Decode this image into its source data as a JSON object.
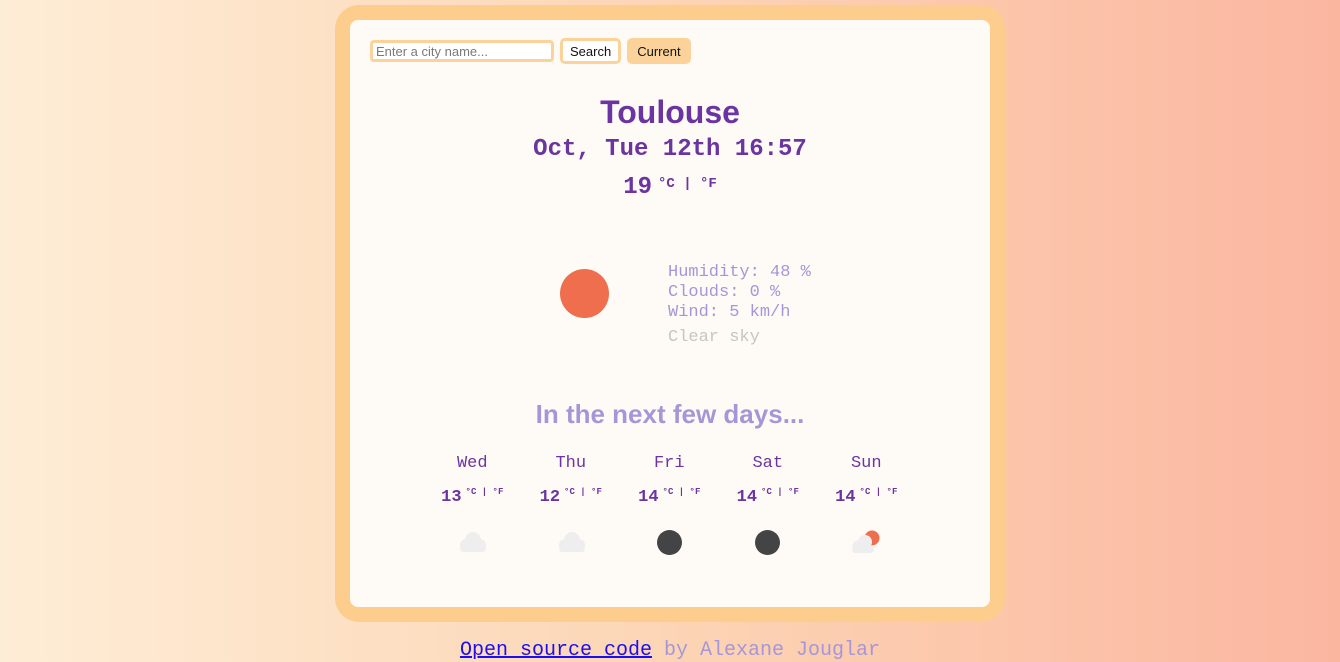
{
  "search": {
    "placeholder": "Enter a city name...",
    "value": ""
  },
  "buttons": {
    "search_label": "Search",
    "current_label": "Current"
  },
  "weather": {
    "city": "Toulouse",
    "datetime": "Oct, Tue 12th 16:57",
    "temperature": "19",
    "units": "°C | °F",
    "icon": "sun-icon",
    "humidity": "Humidity: 48 %",
    "clouds": "Clouds: 0 %",
    "wind": "Wind: 5 km/h",
    "description": "Clear sky"
  },
  "forecast": {
    "title": "In the next few days...",
    "units": "°C | °F",
    "days": [
      {
        "day": "Wed",
        "temp": "13",
        "icon": "cloud-icon"
      },
      {
        "day": "Thu",
        "temp": "12",
        "icon": "cloud-icon"
      },
      {
        "day": "Fri",
        "temp": "14",
        "icon": "moon-icon"
      },
      {
        "day": "Sat",
        "temp": "14",
        "icon": "moon-icon"
      },
      {
        "day": "Sun",
        "temp": "14",
        "icon": "sun-cloud-icon"
      }
    ]
  },
  "footer": {
    "link_text": "Open source code",
    "author": " by Alexane Jouglar"
  },
  "colors": {
    "accent": "#6a35a0",
    "muted": "#a696d8",
    "sun": "#ee6e4d",
    "frame": "#fdcd8d"
  }
}
